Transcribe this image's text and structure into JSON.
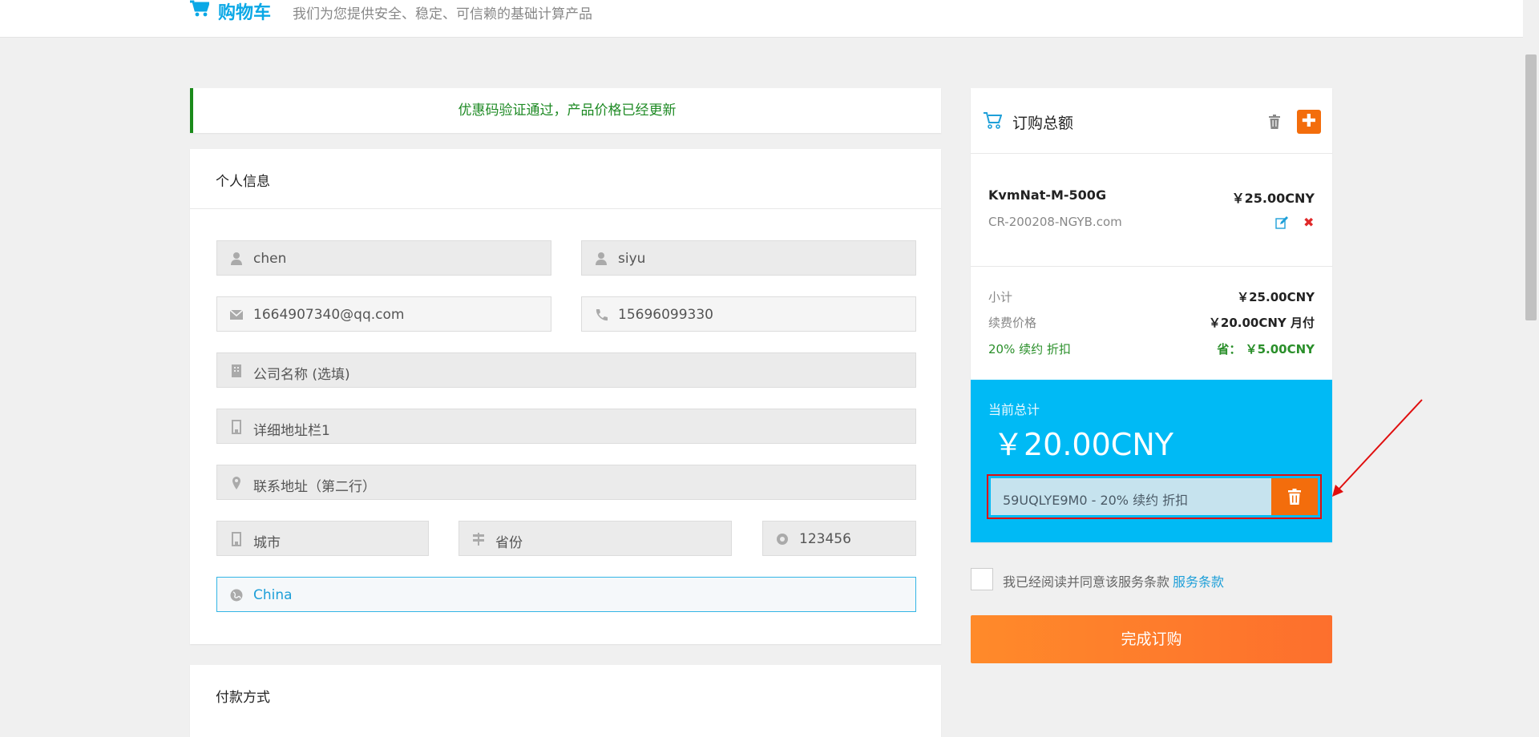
{
  "header": {
    "brand": "购物车",
    "tagline": "我们为您提供安全、稳定、可信赖的基础计算产品"
  },
  "alert": {
    "message": "优惠码验证通过，产品价格已经更新"
  },
  "personal": {
    "title": "个人信息",
    "first_name": "chen",
    "last_name": "siyu",
    "email": "1664907340@qq.com",
    "phone": "15696099330",
    "company_placeholder": "公司名称 (选填)",
    "address1_placeholder": "详细地址栏1",
    "address2_placeholder": "联系地址（第二行）",
    "city_placeholder": "城市",
    "state_placeholder": "省份",
    "postcode": "123456",
    "country": "China"
  },
  "payment": {
    "title": "付款方式"
  },
  "summary": {
    "title": "订购总额",
    "product_name": "KvmNat-M-500G",
    "product_price": "￥25.00CNY",
    "product_domain": "CR-200208-NGYB.com",
    "subtotal_label": "小计",
    "subtotal_value": "￥25.00CNY",
    "renewal_label": "续费价格",
    "renewal_value": "￥20.00CNY 月付",
    "discount_label": "20% 续约 折扣",
    "discount_value": "省：  ￥5.00CNY",
    "total_label": "当前总计",
    "total_value": "￥20.00CNY",
    "promo_code": "59UQLYE9M0 - 20% 续约 折扣",
    "accent_color": "#00baf5",
    "action_color": "#f36d0c"
  },
  "terms": {
    "text": "我已经阅读并同意该服务条款",
    "link": "服务条款"
  },
  "checkout": {
    "label": "完成订购"
  }
}
